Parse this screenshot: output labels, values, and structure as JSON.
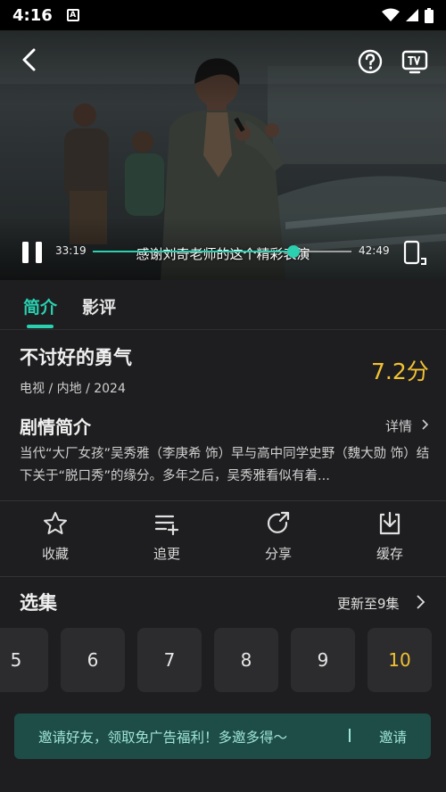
{
  "status_bar": {
    "time": "4:16",
    "a_badge": "A"
  },
  "player": {
    "current_time": "33:19",
    "total_time": "42:49",
    "progress": 0.777,
    "subtitle": "感谢刘奇老师的这个精彩表演"
  },
  "tabs": [
    {
      "label": "简介",
      "active": true
    },
    {
      "label": "影评",
      "active": false
    }
  ],
  "show": {
    "title": "不讨好的勇气",
    "meta": "电视 / 内地 / 2024",
    "score": "7.2分"
  },
  "plot": {
    "heading": "剧情简介",
    "detail_link": "详情",
    "text": "当代“大厂女孩”吴秀雅（李庚希 饰）早与高中同学史野（魏大勋 饰）结下关于“脱口秀”的缘分。多年之后，吴秀雅看似有着..."
  },
  "actions": [
    {
      "label": "收藏",
      "icon": "star-icon"
    },
    {
      "label": "追更",
      "icon": "playlist-add-icon"
    },
    {
      "label": "分享",
      "icon": "share-icon"
    },
    {
      "label": "缓存",
      "icon": "download-icon"
    }
  ],
  "episodes": {
    "heading": "选集",
    "update_text": "更新至9集",
    "items": [
      "5",
      "6",
      "7",
      "8",
      "9",
      "10"
    ],
    "active": "10"
  },
  "invite": {
    "text": "邀请好友，领取免广告福利！多邀多得～",
    "button": "邀请"
  },
  "colors": {
    "accent": "#2ad0b0",
    "score": "#f2c233",
    "background": "#1e1e20",
    "banner": "#1e4d47"
  }
}
